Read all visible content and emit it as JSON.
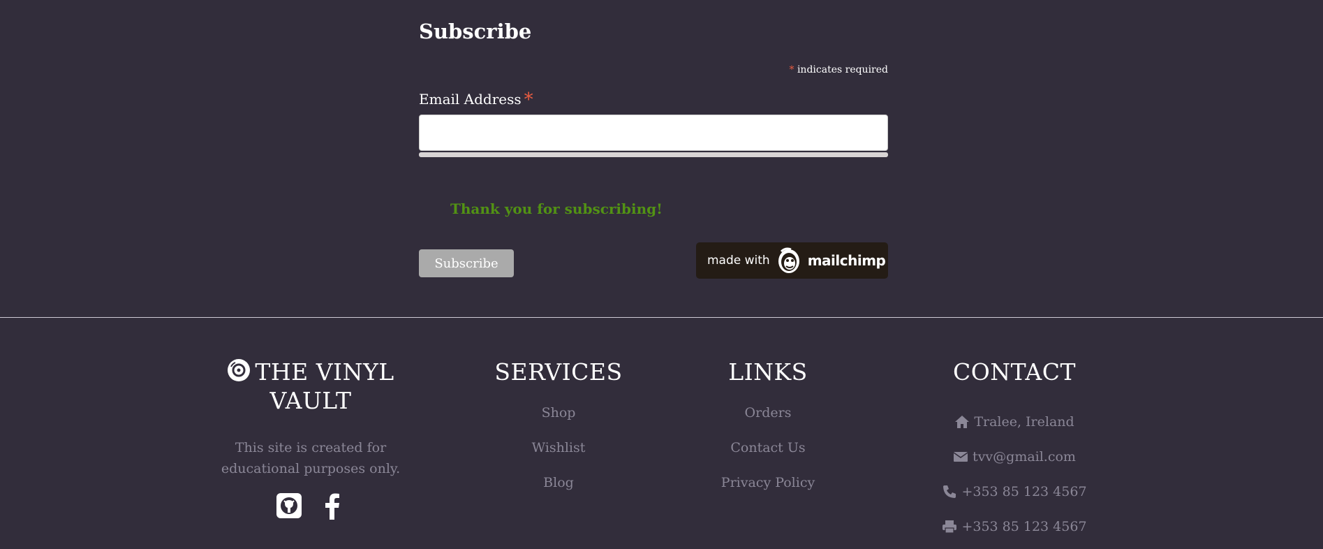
{
  "subscribe": {
    "title": "Subscribe",
    "required_asterisk": "*",
    "required_note": "indicates required",
    "email_label": "Email Address",
    "email_required": "*",
    "email_value": "",
    "success_message": "Thank you for subscribing!",
    "button_label": "Subscribe",
    "badge_made_with": "made with",
    "badge_brand": "mailchimp"
  },
  "footer": {
    "brand": {
      "icon": "vinyl-record-icon",
      "title": "THE VINYL VAULT",
      "description": "This site is created for educational purposes only.",
      "social": [
        {
          "icon": "github-icon"
        },
        {
          "icon": "facebook-icon"
        }
      ]
    },
    "services": {
      "heading": "SERVICES",
      "items": [
        "Shop",
        "Wishlist",
        "Blog"
      ]
    },
    "links": {
      "heading": "LINKS",
      "items": [
        "Orders",
        "Contact Us",
        "Privacy Policy"
      ]
    },
    "contact": {
      "heading": "CONTACT",
      "items": [
        {
          "icon": "home-icon",
          "text": "Tralee, Ireland"
        },
        {
          "icon": "envelope-icon",
          "text": "tvv@gmail.com"
        },
        {
          "icon": "phone-icon",
          "text": "+353 85 123 4567"
        },
        {
          "icon": "fax-icon",
          "text": "+353 85 123 4567"
        }
      ]
    }
  },
  "colors": {
    "background": "#322d3b",
    "success": "#529214",
    "required": "#e85c41",
    "muted_text": "#8b8797",
    "button": "#aaaaaa",
    "mailchimp_badge": "#241c15"
  }
}
